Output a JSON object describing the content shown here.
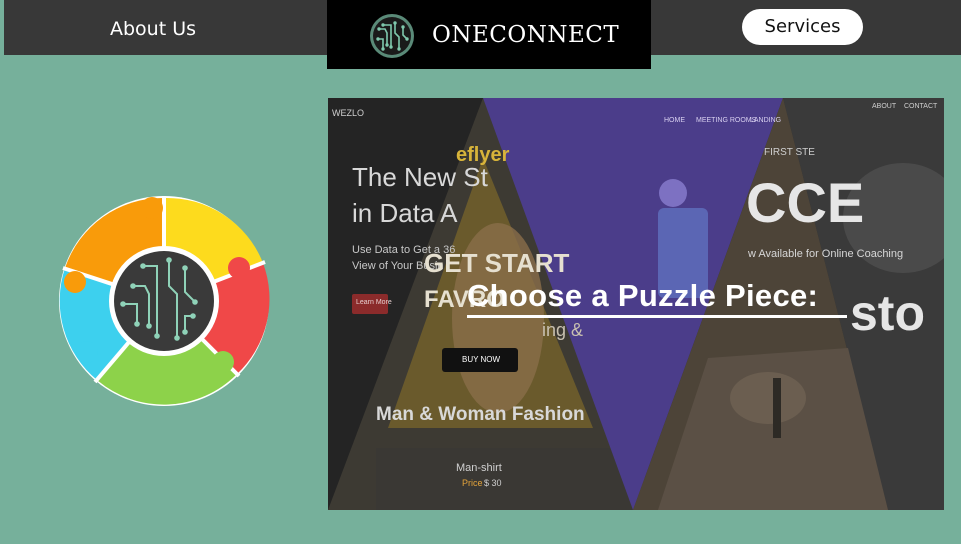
{
  "nav": {
    "about_label": "About Us",
    "brand_name": "ONECONNECT",
    "services_label": "Services"
  },
  "hero": {
    "title": "Choose a Puzzle Piece:",
    "slide1": {
      "nav_name": "WEZLO",
      "headline_1": "The New St",
      "headline_2": "in Data A",
      "body_1": "Use Data to Get a 36",
      "body_2": "View of Your Busin",
      "button": "Learn More"
    },
    "slide2": {
      "brand": "eflyer",
      "cta_1": "GET START",
      "cta_2": "FAVRO",
      "cta_3": "ing &",
      "button": "BUY NOW",
      "section_title": "Man & Woman Fashion",
      "product_name": "Man-shirt",
      "product_price_label": "Price",
      "product_price_value": "$ 30"
    },
    "slide3": {
      "nav_1": "HOME",
      "nav_2": "MEETING ROOMS",
      "nav_3": "LANDING"
    },
    "slide4": {
      "nav_1": "ABOUT",
      "nav_2": "CONTACT",
      "kicker": "FIRST STE",
      "headline": "CCE",
      "sub": "w Available for Online Coaching",
      "big_text": "sto"
    }
  },
  "colors": {
    "page_bg": "#76b09b",
    "topbar_bg": "#383838",
    "brand_bg": "#000000",
    "puzzle_orange": "#f99b0a",
    "puzzle_yellow": "#fddb1d",
    "puzzle_red": "#f04848",
    "puzzle_green": "#8dd24a",
    "puzzle_blue": "#3dd0ee",
    "puzzle_center": "#3a3a3a"
  },
  "icons": {
    "brand_logo": "circuit-brain-icon",
    "puzzle_wheel": "puzzle-wheel-icon"
  }
}
